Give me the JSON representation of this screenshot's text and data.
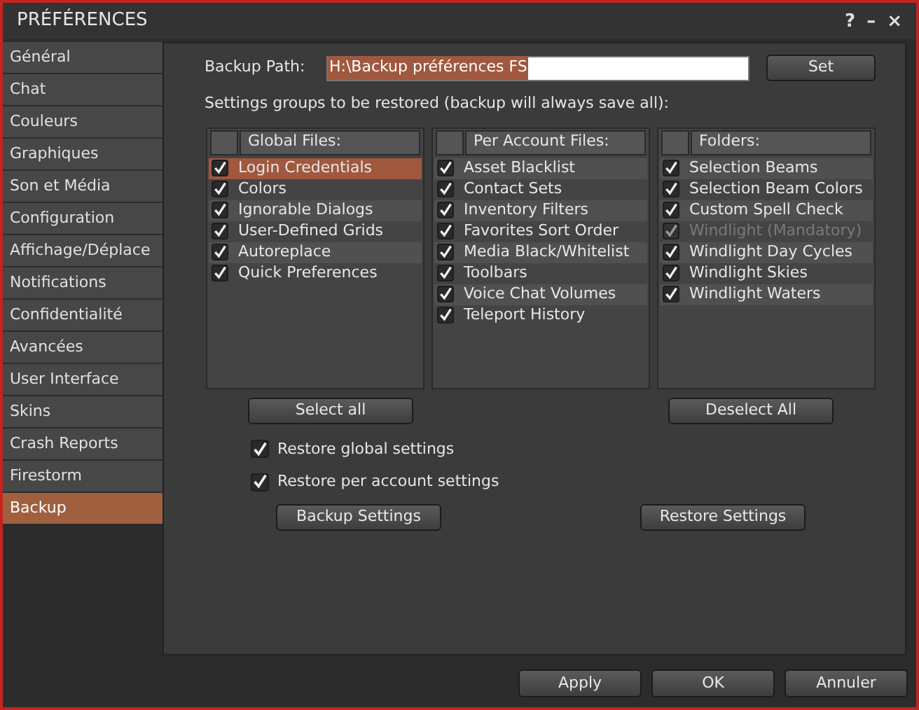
{
  "window": {
    "title": "PRÉFÉRENCES",
    "buttons": [
      "?",
      "–",
      "×"
    ]
  },
  "sidebar": {
    "items": [
      {
        "label": "Général",
        "selected": false
      },
      {
        "label": "Chat",
        "selected": false
      },
      {
        "label": "Couleurs",
        "selected": false
      },
      {
        "label": "Graphiques",
        "selected": false
      },
      {
        "label": "Son et Média",
        "selected": false
      },
      {
        "label": "Configuration",
        "selected": false
      },
      {
        "label": "Affichage/Déplace",
        "selected": false
      },
      {
        "label": "Notifications",
        "selected": false
      },
      {
        "label": "Confidentialité",
        "selected": false
      },
      {
        "label": "Avancées",
        "selected": false
      },
      {
        "label": "User Interface",
        "selected": false
      },
      {
        "label": "Skins",
        "selected": false
      },
      {
        "label": "Crash Reports",
        "selected": false
      },
      {
        "label": "Firestorm",
        "selected": false
      },
      {
        "label": "Backup",
        "selected": true
      }
    ]
  },
  "backup_path": {
    "label": "Backup Path:",
    "value": "H:\\Backup préférences FS",
    "text_highlighted": true,
    "button": "Set"
  },
  "groups_label": "Settings groups to be restored (backup will always save all):",
  "lists": [
    {
      "header": "Global Files:",
      "items": [
        {
          "label": "Login Credentials",
          "checked": true,
          "disabled": false,
          "selected": true
        },
        {
          "label": "Colors",
          "checked": true,
          "disabled": false,
          "selected": false
        },
        {
          "label": "Ignorable Dialogs",
          "checked": true,
          "disabled": false,
          "selected": false
        },
        {
          "label": "User-Defined Grids",
          "checked": true,
          "disabled": false,
          "selected": false
        },
        {
          "label": "Autoreplace",
          "checked": true,
          "disabled": false,
          "selected": false
        },
        {
          "label": "Quick Preferences",
          "checked": true,
          "disabled": false,
          "selected": false
        }
      ]
    },
    {
      "header": "Per Account Files:",
      "items": [
        {
          "label": "Asset Blacklist",
          "checked": true,
          "disabled": false,
          "selected": false
        },
        {
          "label": "Contact Sets",
          "checked": true,
          "disabled": false,
          "selected": false
        },
        {
          "label": "Inventory Filters",
          "checked": true,
          "disabled": false,
          "selected": false
        },
        {
          "label": "Favorites Sort Order",
          "checked": true,
          "disabled": false,
          "selected": false
        },
        {
          "label": "Media Black/Whitelist",
          "checked": true,
          "disabled": false,
          "selected": false
        },
        {
          "label": "Toolbars",
          "checked": true,
          "disabled": false,
          "selected": false
        },
        {
          "label": "Voice Chat Volumes",
          "checked": true,
          "disabled": false,
          "selected": false
        },
        {
          "label": "Teleport History",
          "checked": true,
          "disabled": false,
          "selected": false
        }
      ]
    },
    {
      "header": "Folders:",
      "items": [
        {
          "label": "Selection Beams",
          "checked": true,
          "disabled": false,
          "selected": false
        },
        {
          "label": "Selection Beam Colors",
          "checked": true,
          "disabled": false,
          "selected": false
        },
        {
          "label": "Custom Spell Check",
          "checked": true,
          "disabled": false,
          "selected": false
        },
        {
          "label": "Windlight (Mandatory)",
          "checked": true,
          "disabled": true,
          "selected": false
        },
        {
          "label": "Windlight Day Cycles",
          "checked": true,
          "disabled": false,
          "selected": false
        },
        {
          "label": "Windlight Skies",
          "checked": true,
          "disabled": false,
          "selected": false
        },
        {
          "label": "Windlight Waters",
          "checked": true,
          "disabled": false,
          "selected": false
        }
      ]
    }
  ],
  "select_all": "Select all",
  "deselect_all": "Deselect All",
  "options": [
    {
      "label": "Restore global settings",
      "checked": true
    },
    {
      "label": "Restore per account settings",
      "checked": true
    }
  ],
  "backup_button": "Backup Settings",
  "restore_button": "Restore Settings",
  "footer_buttons": [
    "Apply",
    "OK",
    "Annuler"
  ]
}
